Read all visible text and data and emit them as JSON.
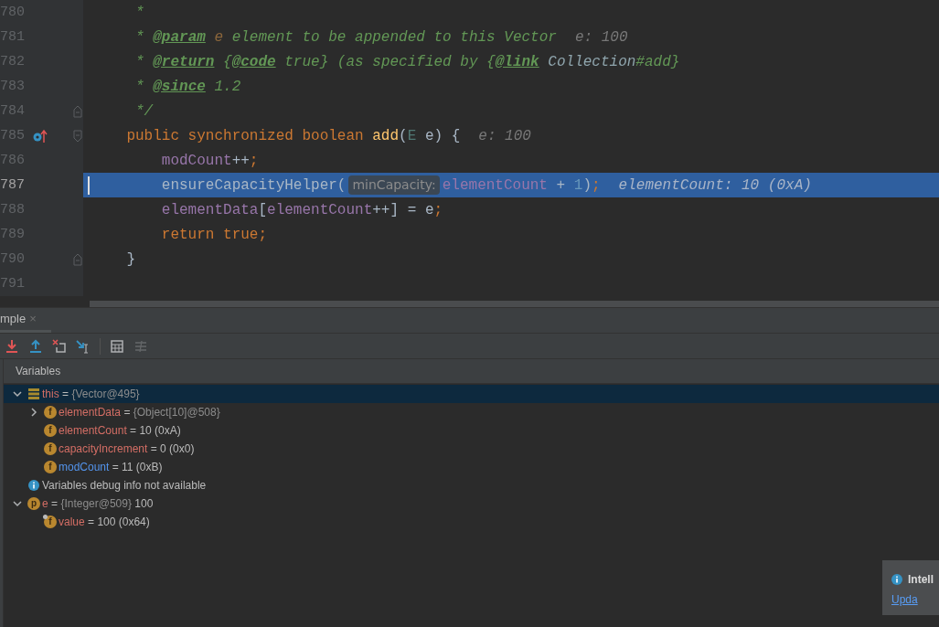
{
  "editor": {
    "lines": [
      {
        "number": "780",
        "current": false,
        "tokens": [
          {
            "kind": "comment",
            "text": "     *"
          }
        ]
      },
      {
        "number": "781",
        "current": false,
        "inline_value": "e: 100",
        "tokens": [
          {
            "kind": "comment",
            "text": "     * "
          },
          {
            "kind": "doctag",
            "text": "@param"
          },
          {
            "kind": "docparam",
            "text": " e"
          },
          {
            "kind": "comment",
            "text": " element to be appended to this Vector"
          }
        ]
      },
      {
        "number": "782",
        "current": false,
        "tokens": [
          {
            "kind": "comment",
            "text": "     * "
          },
          {
            "kind": "doctag",
            "text": "@return"
          },
          {
            "kind": "comment",
            "text": " {"
          },
          {
            "kind": "doctag",
            "text": "@code"
          },
          {
            "kind": "comment",
            "text": " true} (as specified by {"
          },
          {
            "kind": "doctag",
            "text": "@link"
          },
          {
            "kind": "docref",
            "text": " Collection"
          },
          {
            "kind": "comment",
            "text": "#add}"
          }
        ]
      },
      {
        "number": "783",
        "current": false,
        "tokens": [
          {
            "kind": "comment",
            "text": "     * "
          },
          {
            "kind": "doctag",
            "text": "@since"
          },
          {
            "kind": "comment",
            "text": " 1.2"
          }
        ]
      },
      {
        "number": "784",
        "current": false,
        "gutter": [
          {
            "kind": "fold-end"
          }
        ],
        "tokens": [
          {
            "kind": "comment",
            "text": "     */"
          }
        ]
      },
      {
        "number": "785",
        "current": false,
        "gutter": [
          {
            "kind": "override"
          },
          {
            "kind": "fold-start"
          }
        ],
        "inline_value": "e: 100",
        "tokens": [
          {
            "kind": "keyword",
            "text": "    public synchronized boolean "
          },
          {
            "kind": "method",
            "text": "add"
          },
          {
            "kind": "plain",
            "text": "("
          },
          {
            "kind": "typeparam",
            "text": "E"
          },
          {
            "kind": "plain",
            "text": " e) {"
          }
        ]
      },
      {
        "number": "786",
        "current": false,
        "tokens": [
          {
            "kind": "field",
            "text": "        modCount"
          },
          {
            "kind": "plain",
            "text": "++"
          },
          {
            "kind": "keyword",
            "text": ";"
          }
        ]
      },
      {
        "number": "787",
        "current": true,
        "inline_value": "elementCount: 10 (0xA)",
        "tokens": [
          {
            "kind": "plain",
            "text": "        ensureCapacityHelper("
          },
          {
            "kind": "hint",
            "text": "minCapacity:"
          },
          {
            "kind": "field",
            "text": "elementCount"
          },
          {
            "kind": "plain",
            "text": " + "
          },
          {
            "kind": "number",
            "text": "1"
          },
          {
            "kind": "plain",
            "text": ")"
          },
          {
            "kind": "keyword",
            "text": ";"
          }
        ]
      },
      {
        "number": "788",
        "current": false,
        "tokens": [
          {
            "kind": "field",
            "text": "        elementData"
          },
          {
            "kind": "plain",
            "text": "["
          },
          {
            "kind": "field",
            "text": "elementCount"
          },
          {
            "kind": "plain",
            "text": "++] = e"
          },
          {
            "kind": "keyword",
            "text": ";"
          }
        ]
      },
      {
        "number": "789",
        "current": false,
        "tokens": [
          {
            "kind": "keyword",
            "text": "        return true;"
          }
        ]
      },
      {
        "number": "790",
        "current": false,
        "gutter": [
          {
            "kind": "fold-end"
          }
        ],
        "tokens": [
          {
            "kind": "plain",
            "text": "    }"
          }
        ]
      },
      {
        "number": "791",
        "current": false
      }
    ]
  },
  "debugger": {
    "tab": {
      "label": "mple",
      "close": "×"
    },
    "toolbar": [
      {
        "kind": "step-into-red",
        "disabled": false
      },
      {
        "kind": "step-out",
        "disabled": false
      },
      {
        "kind": "drop-frame",
        "disabled": false
      },
      {
        "kind": "run-to-cursor",
        "disabled": false
      },
      {
        "kind": "evaluate",
        "disabled": false
      },
      {
        "kind": "trace",
        "disabled": true
      }
    ],
    "variables_title": "Variables",
    "tree": [
      {
        "kind": "object",
        "name": "this",
        "separator": "=",
        "ref": "{Vector@495}",
        "expanded": true,
        "selected": true,
        "children": [
          {
            "kind": "field",
            "badge": "f",
            "name": "elementData",
            "separator": "=",
            "ref": "{Object[10]@508}",
            "expanded": false,
            "selected": false
          },
          {
            "kind": "field",
            "badge": "f",
            "name": "elementCount",
            "separator": "=",
            "value": "10 (0xA)",
            "changed": false,
            "selected": false
          },
          {
            "kind": "field",
            "badge": "f",
            "name": "capacityIncrement",
            "separator": "=",
            "value": "0 (0x0)",
            "changed": false,
            "selected": false
          },
          {
            "kind": "field",
            "badge": "f",
            "name": "modCount",
            "separator": "=",
            "value": "11 (0xB)",
            "changed": true,
            "selected": false
          }
        ]
      },
      {
        "kind": "info",
        "text": "Variables debug info not available",
        "selected": false
      },
      {
        "kind": "param",
        "badge": "p",
        "name": "e",
        "separator": "=",
        "ref": "{Integer@509}",
        "value": "100",
        "expanded": true,
        "selected": false,
        "children": [
          {
            "kind": "field-final",
            "badge": "f",
            "name": "value",
            "separator": "=",
            "value": "100 (0x64)",
            "changed": false,
            "selected": false
          }
        ]
      }
    ]
  },
  "notification": {
    "title": "Intell",
    "link": "Upda"
  }
}
